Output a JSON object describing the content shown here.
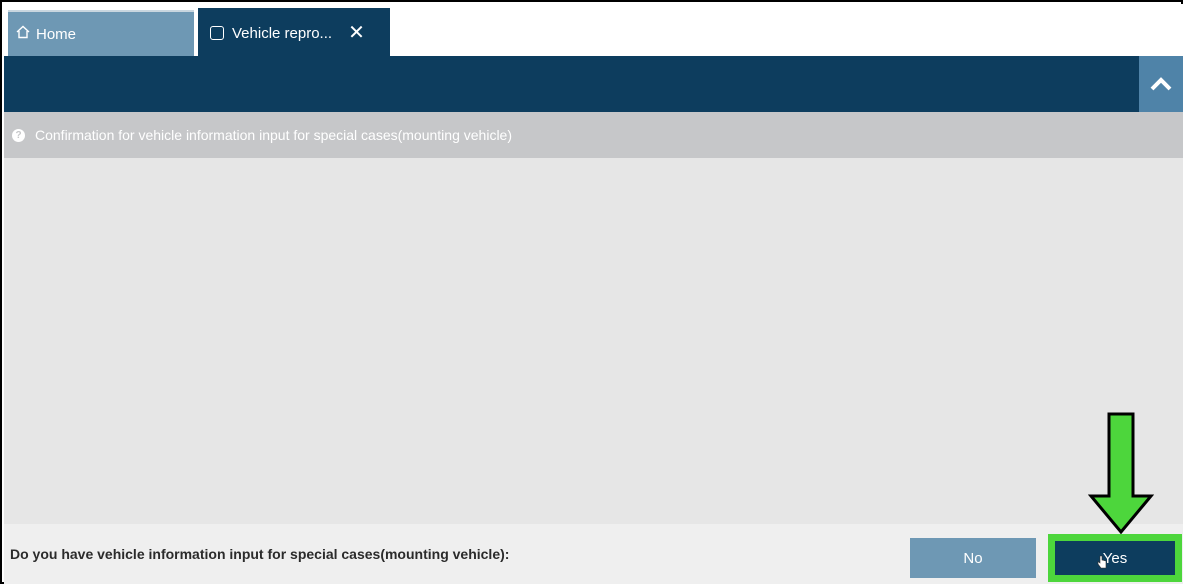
{
  "tabs": [
    {
      "label": "Home",
      "icon": "home-icon"
    },
    {
      "label": "Vehicle repro...",
      "icon": "document-icon",
      "close_icon": "close-icon"
    }
  ],
  "header": {
    "collapse_icon": "chevron-up-icon"
  },
  "info": {
    "icon": "question-icon",
    "text": "Confirmation for vehicle information input for special cases(mounting vehicle)"
  },
  "bottom": {
    "question": "Do you have vehicle information input for special cases(mounting vehicle):",
    "no_label": "No",
    "yes_label": "Yes"
  },
  "annotation": {
    "arrow_color": "#4dd63c",
    "highlight_color": "#4dd63c"
  },
  "colors": {
    "primary": "#0d3d5e",
    "secondary": "#6e98b4",
    "info_bar": "#c6c7c9",
    "content_bg": "#e6e6e6"
  }
}
